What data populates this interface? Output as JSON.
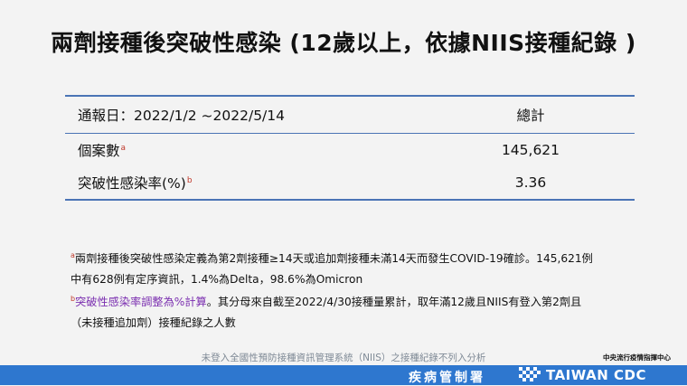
{
  "title": "兩劑接種後突破性感染 (12歲以上，依據NIIS接種紀錄 )",
  "table": {
    "header_label": "通報日：2022/1/2 ~2022/5/14",
    "header_value": "總計",
    "rows": [
      {
        "label": "個案數",
        "sup": "a",
        "value": "145,621"
      },
      {
        "label": "突破性感染率(%)",
        "sup": "b",
        "value": "3.36"
      }
    ]
  },
  "notes": {
    "a_marker": "a",
    "a_text_1": "兩劑接種後突破性感染定義為第2劑接種≥14天或追加劑接種未滿14天而發生COVID-19確診。145,621例",
    "a_text_2": "中有628例有定序資訊，1.4%為Delta，98.6%為Omicron",
    "b_marker": "b",
    "b_highlight": "突破性感染率調整為%計算",
    "b_text_1": "。其分母來自截至2022/4/30接種量累計，取年滿12歲且NIIS有登入第2劑且",
    "b_text_2": "（未接種追加劑）接種紀錄之人數"
  },
  "footnote": "未登入全國性預防接種資訊管理系統（NIIS）之接種紀錄不列入分析",
  "branding": {
    "center": "中央流行疫情指揮中心",
    "zh": "疾病管制署",
    "en": "TAIWAN CDC",
    "bar_color": "#2e77cf"
  }
}
